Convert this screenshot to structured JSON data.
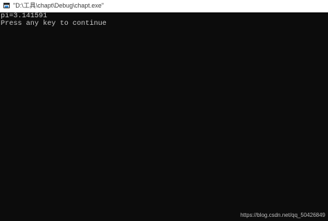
{
  "window": {
    "title": "\"D:\\工具\\chapt\\Debug\\chapt.exe\"",
    "icon": "console-app-icon"
  },
  "console": {
    "lines": [
      "pi=3.141591",
      "Press any key to continue"
    ]
  },
  "watermark": {
    "text": "https://blog.csdn.net/qq_50426849"
  },
  "colors": {
    "console_background": "#0c0c0c",
    "console_text": "#c9c9c9",
    "titlebar_background": "#ffffff",
    "icon_accent": "#3b8fd8"
  }
}
